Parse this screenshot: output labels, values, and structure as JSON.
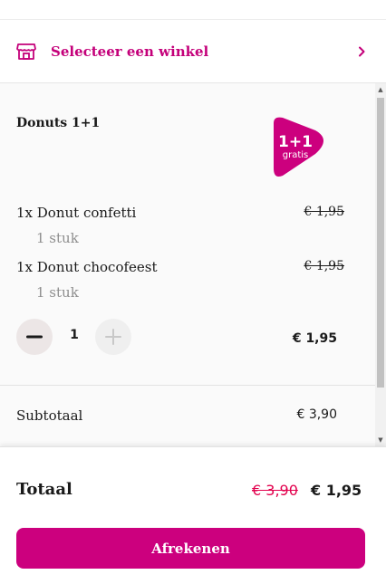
{
  "store": {
    "label": "Selecteer een winkel",
    "icon": "store-icon",
    "chevron_icon": "chevron-right-icon"
  },
  "promo": {
    "title": "Donuts 1+1",
    "badge_main": "1+1",
    "badge_sub": "gratis",
    "items": [
      {
        "name": "1x Donut confetti",
        "price": "€ 1,95",
        "quantity_text": "1 stuk"
      },
      {
        "name": "1x Donut chocofeest",
        "price": "€ 1,95",
        "quantity_text": "1 stuk"
      }
    ],
    "stepper_value": "1",
    "group_total": "€ 1,95"
  },
  "summary": {
    "subtotal_label": "Subtotaal",
    "subtotal_value": "€ 3,90"
  },
  "footer": {
    "total_label": "Totaal",
    "total_old": "€ 3,90",
    "total_new": "€ 1,95",
    "checkout_label": "Afrekenen"
  },
  "colors": {
    "brand": "#cc007e",
    "strike_red": "#e2004d",
    "muted": "#8e8e8e"
  }
}
